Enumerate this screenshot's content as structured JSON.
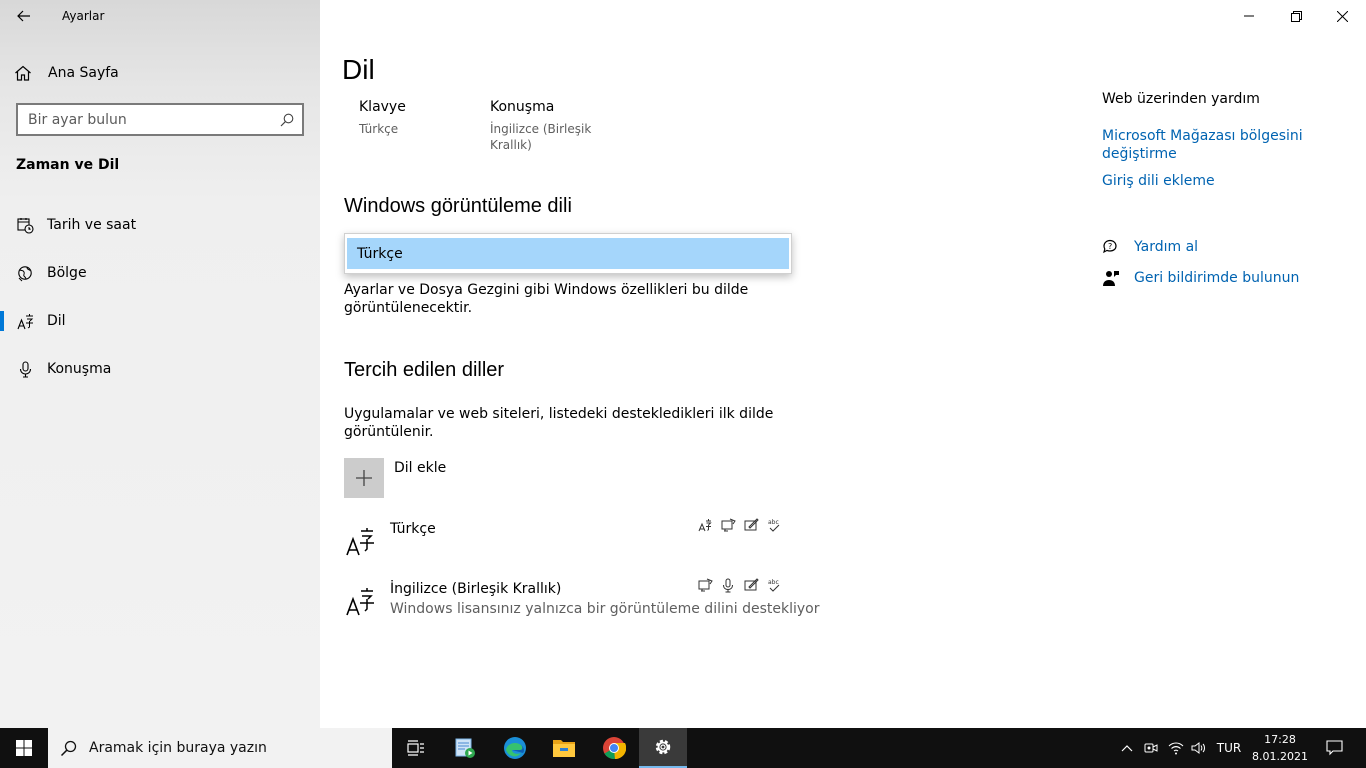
{
  "window": {
    "app_title": "Ayarlar"
  },
  "sidebar": {
    "home_label": "Ana Sayfa",
    "search_placeholder": "Bir ayar bulun",
    "section_title": "Zaman ve Dil",
    "items": [
      {
        "label": "Tarih ve saat",
        "icon": "calendar-clock-icon",
        "selected": false
      },
      {
        "label": "Bölge",
        "icon": "globe-icon",
        "selected": false
      },
      {
        "label": "Dil",
        "icon": "language-icon",
        "selected": true
      },
      {
        "label": "Konuşma",
        "icon": "microphone-icon",
        "selected": false
      }
    ]
  },
  "main": {
    "title": "Dil",
    "keyboard": {
      "label": "Klavye",
      "value": "Türkçe"
    },
    "speech": {
      "label": "Konuşma",
      "value_line1": "İngilizce (Birleşik",
      "value_line2": "Krallık)"
    },
    "display_language": {
      "heading": "Windows görüntüleme dili",
      "selected": "Türkçe",
      "desc_line1": "Ayarlar ve Dosya Gezgini gibi Windows özellikleri bu dilde",
      "desc_line2": "görüntülenecektir."
    },
    "preferred": {
      "heading": "Tercih edilen diller",
      "desc_line1": "Uygulamalar ve web siteleri, listedeki destekledikleri ilk dilde",
      "desc_line2": "görüntülenir.",
      "add_label": "Dil ekle",
      "languages": [
        {
          "name": "Türkçe",
          "sub": "",
          "features": [
            "display-language-icon",
            "text-to-speech-icon",
            "handwriting-icon",
            "spell-check-icon"
          ]
        },
        {
          "name": "İngilizce (Birleşik Krallık)",
          "sub": "Windows lisansınız yalnızca bir görüntüleme dilini destekliyor",
          "features": [
            "text-to-speech-icon",
            "microphone-icon",
            "handwriting-icon",
            "spell-check-icon"
          ]
        }
      ]
    }
  },
  "right_panel": {
    "web_help_title": "Web üzerinden yardım",
    "links": [
      "Microsoft Mağazası bölgesini değiştirme",
      "Giriş dili ekleme"
    ],
    "link1_line1": "Microsoft Mağazası bölgesini",
    "link1_line2": "değiştirme",
    "get_help": "Yardım al",
    "feedback": "Geri bildirimde bulunun"
  },
  "taskbar": {
    "search_placeholder": "Aramak için buraya yazın",
    "apps": [
      "task-view-icon",
      "photos-video-icon",
      "edge-icon",
      "file-explorer-icon",
      "chrome-icon",
      "settings-gear-icon"
    ],
    "language": "TUR",
    "time": "17:28",
    "date": "8.01.2021"
  },
  "colors": {
    "accent": "#0078d7",
    "link": "#0063b1",
    "selection": "#a5d6fb",
    "taskbar": "#101010"
  }
}
